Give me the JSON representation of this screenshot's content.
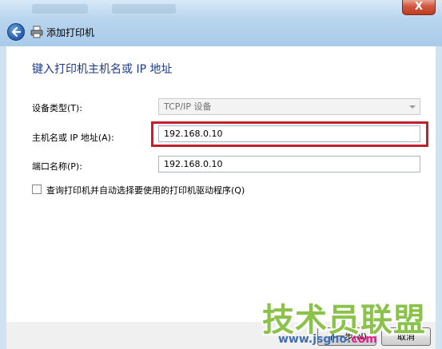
{
  "window": {
    "title": "添加打印机",
    "close_label": "X"
  },
  "heading": "键入打印机主机名或 IP 地址",
  "form": {
    "device_type_label": "设备类型(T):",
    "device_type_value": "TCP/IP 设备",
    "host_label": "主机名或 IP 地址(A):",
    "host_value": "192.168.0.10",
    "port_label": "端口名称(P):",
    "port_value": "192.168.0.10",
    "query_checkbox_label": "查询打印机并自动选择要使用的打印机驱动程序(Q)",
    "query_checked": false
  },
  "footer": {
    "next_label": "下一步(N)",
    "cancel_label": "取消"
  },
  "watermark": {
    "text": "技术员联盟",
    "url_prefix": "www.jsgho.",
    "url_suffix": "com"
  },
  "colors": {
    "highlight": "#c0202a",
    "heading": "#1e3a8a",
    "watermark": "#8bc34a"
  }
}
